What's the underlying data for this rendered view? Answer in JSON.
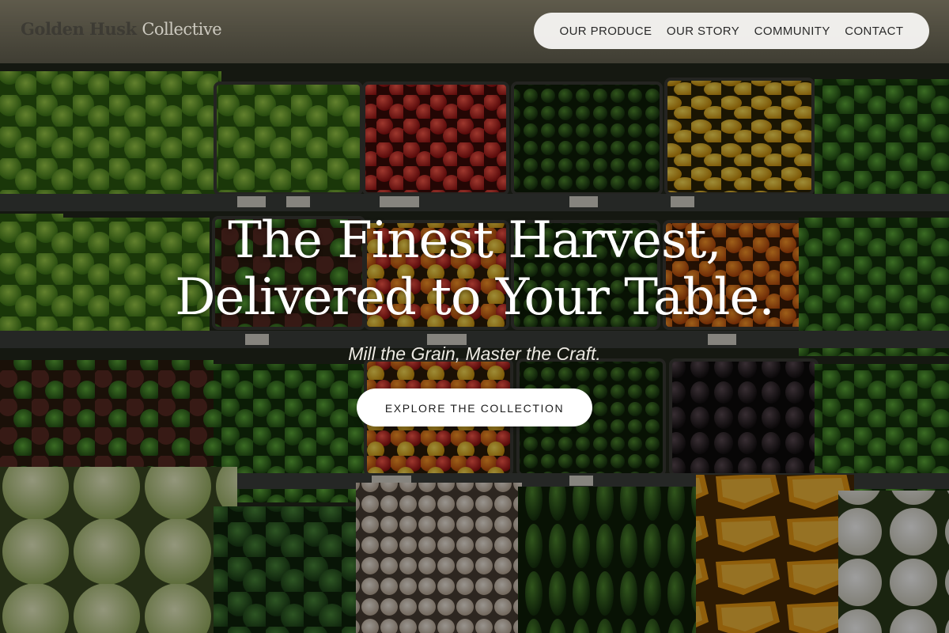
{
  "brand": {
    "name_part1": "Golden Husk",
    "name_part2": "Collective"
  },
  "nav": {
    "items": [
      {
        "label": "OUR PRODUCE"
      },
      {
        "label": "OUR STORY"
      },
      {
        "label": "COMMUNITY"
      },
      {
        "label": "CONTACT"
      }
    ]
  },
  "hero": {
    "headline_line1": "The Finest Harvest,",
    "headline_line2": "Delivered to Your Table.",
    "tagline": "Mill the Grain, Master the Craft.",
    "cta_label": "EXPLORE THE COLLECTION"
  },
  "colors": {
    "nav_pill_bg": "#f8f7f4",
    "cta_bg": "#ffffff",
    "headline": "#ffffff"
  }
}
